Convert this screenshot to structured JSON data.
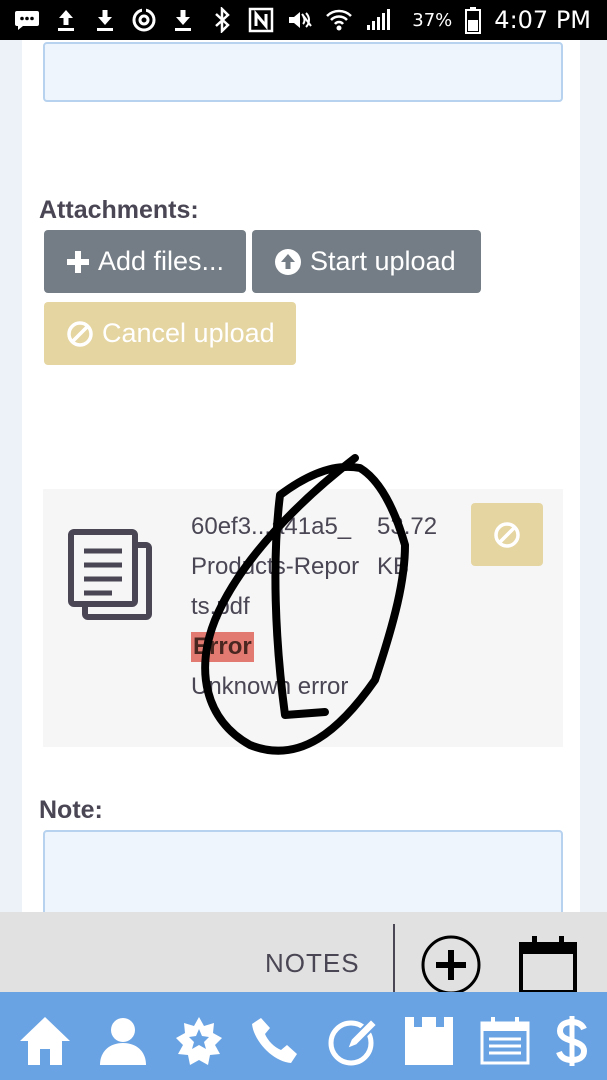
{
  "status_bar": {
    "battery_percent": "37%",
    "time": "4:07 PM",
    "icons": [
      "messages-icon",
      "upload-icon",
      "download-icon",
      "sync-icon",
      "download-icon",
      "bluetooth-icon",
      "nfc-icon",
      "mute-icon",
      "wifi-icon",
      "signal-icon",
      "battery-icon"
    ]
  },
  "form": {
    "attachments_label": "Attachments:",
    "add_files_label": "Add files...",
    "start_upload_label": "Start upload",
    "cancel_upload_label": "Cancel upload",
    "note_label": "Note:"
  },
  "file": {
    "name": "60ef3...a41a5_Products-Reports.pdf",
    "name_visible_parts": [
      "60ef3",
      "6a41",
      "a5_Products",
      "-Reports.pdf"
    ],
    "size": "53.72 KB",
    "status": "Error",
    "message": "Unknown error"
  },
  "notes_bar": {
    "label": "NOTES",
    "icons": [
      "add-circle-icon",
      "calendar-icon"
    ]
  },
  "nav": {
    "icons": [
      "home-icon",
      "person-icon",
      "badge-icon",
      "phone-icon",
      "edit-icon",
      "clapper-icon",
      "calendar-icon",
      "dollar-icon"
    ]
  },
  "colors": {
    "nav_background": "#6aa3e3",
    "grey_button": "#747d85",
    "yellow_button": "#e5d5a1",
    "error_badge": "#e27a72",
    "field_border": "#b7d2ee"
  }
}
